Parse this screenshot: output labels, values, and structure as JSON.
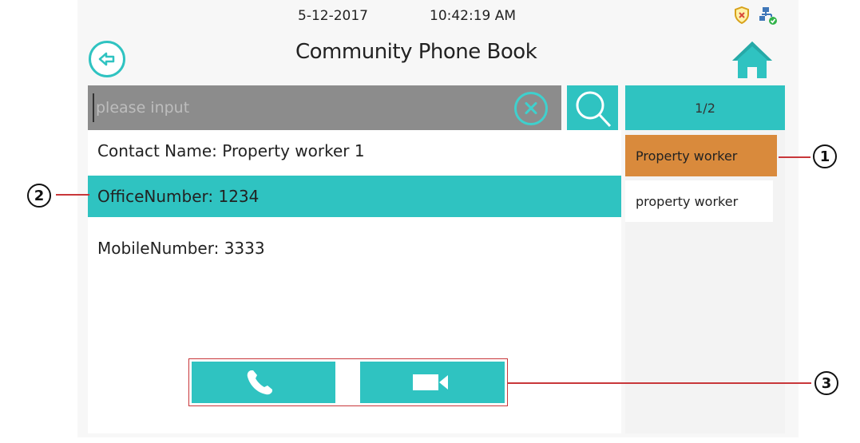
{
  "status": {
    "date": "5-12-2017",
    "time": "10:42:19 AM"
  },
  "header": {
    "title": "Community Phone Book"
  },
  "search": {
    "placeholder": "please input",
    "value": ""
  },
  "pagination": {
    "label": "1/2"
  },
  "contact": {
    "name_line": "Contact Name: Property worker 1",
    "office_line": "OfficeNumber: 1234",
    "mobile_line": "MobileNumber: 3333"
  },
  "categories": [
    {
      "label": "Property worker",
      "active": true
    },
    {
      "label": "property worker",
      "active": false
    }
  ],
  "callouts": [
    "1",
    "2",
    "3"
  ],
  "colors": {
    "accent": "#2fc3c1",
    "selected_category": "#d98a3c",
    "callout_line": "#c8373a"
  },
  "icons": [
    "back-arrow-icon",
    "home-icon",
    "shield-icon",
    "network-icon",
    "clear-icon",
    "search-icon",
    "phone-icon",
    "video-camera-icon"
  ]
}
